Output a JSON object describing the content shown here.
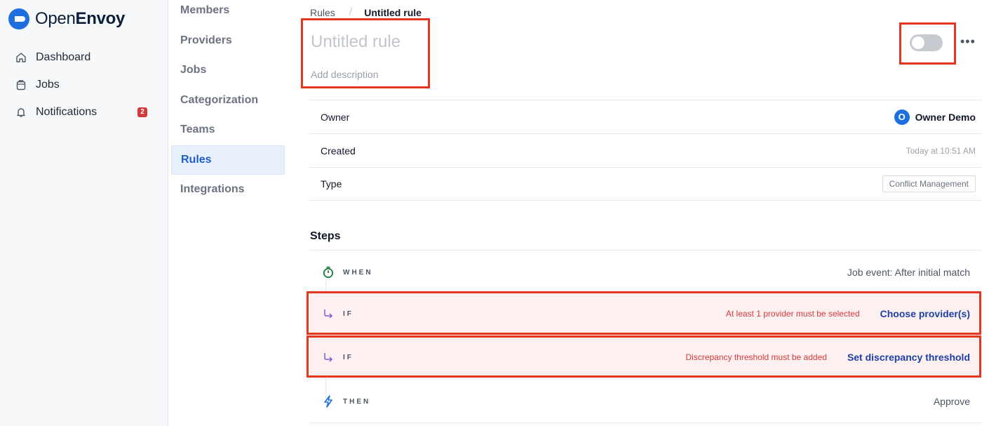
{
  "app": {
    "logo_part1": "Open",
    "logo_part2": "Envoy",
    "nav": [
      {
        "label": "Dashboard",
        "icon": "home-icon"
      },
      {
        "label": "Jobs",
        "icon": "clipboard-icon"
      },
      {
        "label": "Notifications",
        "icon": "bell-icon",
        "badge": "2"
      }
    ]
  },
  "settings_menu": [
    "Members",
    "Providers",
    "Jobs",
    "Categorization",
    "Teams",
    "Rules",
    "Integrations"
  ],
  "settings_menu_active": "Rules",
  "breadcrumb": {
    "parent": "Rules",
    "separator": "/",
    "current": "Untitled rule"
  },
  "rule": {
    "title_placeholder": "Untitled rule",
    "description_placeholder": "Add description",
    "enabled": false,
    "more_label": "•••"
  },
  "properties": {
    "owner_label": "Owner",
    "owner_initial": "O",
    "owner_name": "Owner Demo",
    "created_label": "Created",
    "created_value": "Today at 10:51 AM",
    "type_label": "Type",
    "type_value": "Conflict Management"
  },
  "steps": {
    "title": "Steps",
    "items": [
      {
        "kind": "WHEN",
        "icon": "timer-icon",
        "value": "Job event: After initial match"
      },
      {
        "kind": "IF",
        "icon": "branch-arrow-icon",
        "error": "At least 1 provider must be selected",
        "action": "Choose provider(s)"
      },
      {
        "kind": "IF",
        "icon": "branch-arrow-icon",
        "error": "Discrepancy threshold must be added",
        "action": "Set discrepancy threshold"
      },
      {
        "kind": "THEN",
        "icon": "lightning-icon",
        "value": "Approve"
      }
    ]
  },
  "colors": {
    "accent": "#1d6fe0",
    "error": "#d43a3a",
    "highlight_border": "#e5371f",
    "active_bg": "#e8f0fb"
  }
}
